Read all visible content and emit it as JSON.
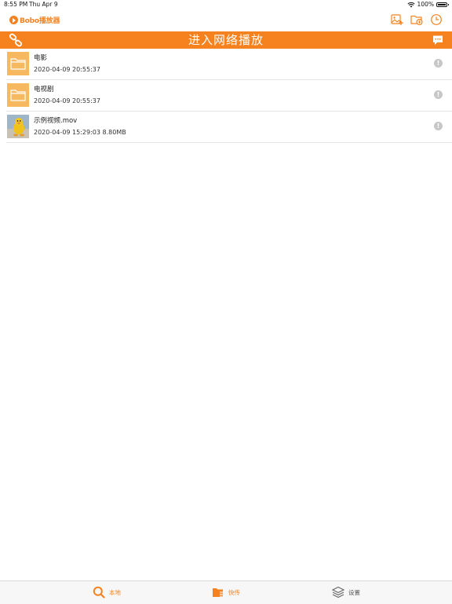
{
  "status_bar": {
    "time": "8:55 PM",
    "date": "Thu Apr 9",
    "battery": "100%",
    "battery_level": 1.0
  },
  "navbar": {
    "logo_text": "Bobo播放器",
    "icons": [
      "add-image-icon",
      "folder-add-icon",
      "history-clock-icon"
    ]
  },
  "banner": {
    "title": "进入网络播放",
    "left_icon": "link-icon",
    "right_icon": "message-icon"
  },
  "files": [
    {
      "name": "电影",
      "meta": "2020-04-09 20:55:37",
      "type": "folder"
    },
    {
      "name": "电视剧",
      "meta": "2020-04-09 20:55:37",
      "type": "folder"
    },
    {
      "name": "示例视频.mov",
      "meta": "2020-04-09 15:29:03 8.80MB",
      "type": "video"
    }
  ],
  "info_icon_glyph": "!",
  "tabs": [
    {
      "label": "本地",
      "icon": "search-icon",
      "active": true
    },
    {
      "label": "快传",
      "icon": "transfer-folder-icon",
      "active": false
    },
    {
      "label": "设置",
      "icon": "layers-icon",
      "active": false
    }
  ],
  "colors": {
    "accent": "#f5821f",
    "folder": "#f7b95f",
    "info_gray": "#c7c7c7"
  }
}
